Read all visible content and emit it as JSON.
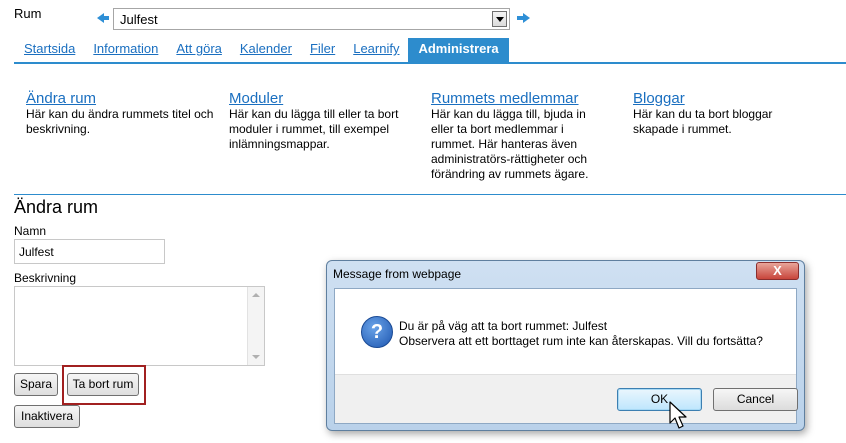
{
  "room": {
    "label": "Rum",
    "selected": "Julfest",
    "prev_icon": "arrow-left-icon",
    "next_icon": "arrow-right-icon"
  },
  "tabs": [
    {
      "label": "Startsida",
      "active": false
    },
    {
      "label": "Information",
      "active": false
    },
    {
      "label": "Att göra",
      "active": false
    },
    {
      "label": "Kalender",
      "active": false
    },
    {
      "label": "Filer",
      "active": false
    },
    {
      "label": "Learnify",
      "active": false
    },
    {
      "label": "Administrera",
      "active": true
    }
  ],
  "admin_sections": [
    {
      "title": "Ändra rum",
      "description": "Här kan du ändra rummets titel och beskrivning."
    },
    {
      "title": "Moduler",
      "description": "Här kan du lägga till eller ta bort moduler i rummet, till exempel inlämningsmappar."
    },
    {
      "title": "Rummets medlemmar",
      "description": "Här kan du lägga till, bjuda in eller ta bort medlemmar i rummet. Här hanteras även administratörs-rättigheter och förändring av rummets ägare."
    },
    {
      "title": "Bloggar",
      "description": "Här kan du ta bort bloggar skapade i rummet."
    }
  ],
  "form": {
    "heading": "Ändra rum",
    "name_label": "Namn",
    "name_value": "Julfest",
    "description_label": "Beskrivning",
    "description_value": "",
    "save_button": "Spara",
    "delete_button": "Ta bort rum",
    "deactivate_button": "Inaktivera"
  },
  "dialog": {
    "title": "Message from webpage",
    "close_label": "X",
    "icon": "question-icon",
    "message_line1": "Du är på väg att ta bort rummet: Julfest",
    "message_line2": "Observera att ett borttaget rum inte kan återskapas. Vill du fortsätta?",
    "ok_label": "OK",
    "cancel_label": "Cancel"
  },
  "colors": {
    "accent": "#2d8ccd",
    "link": "#1a6fc0",
    "highlight": "#a12020"
  }
}
